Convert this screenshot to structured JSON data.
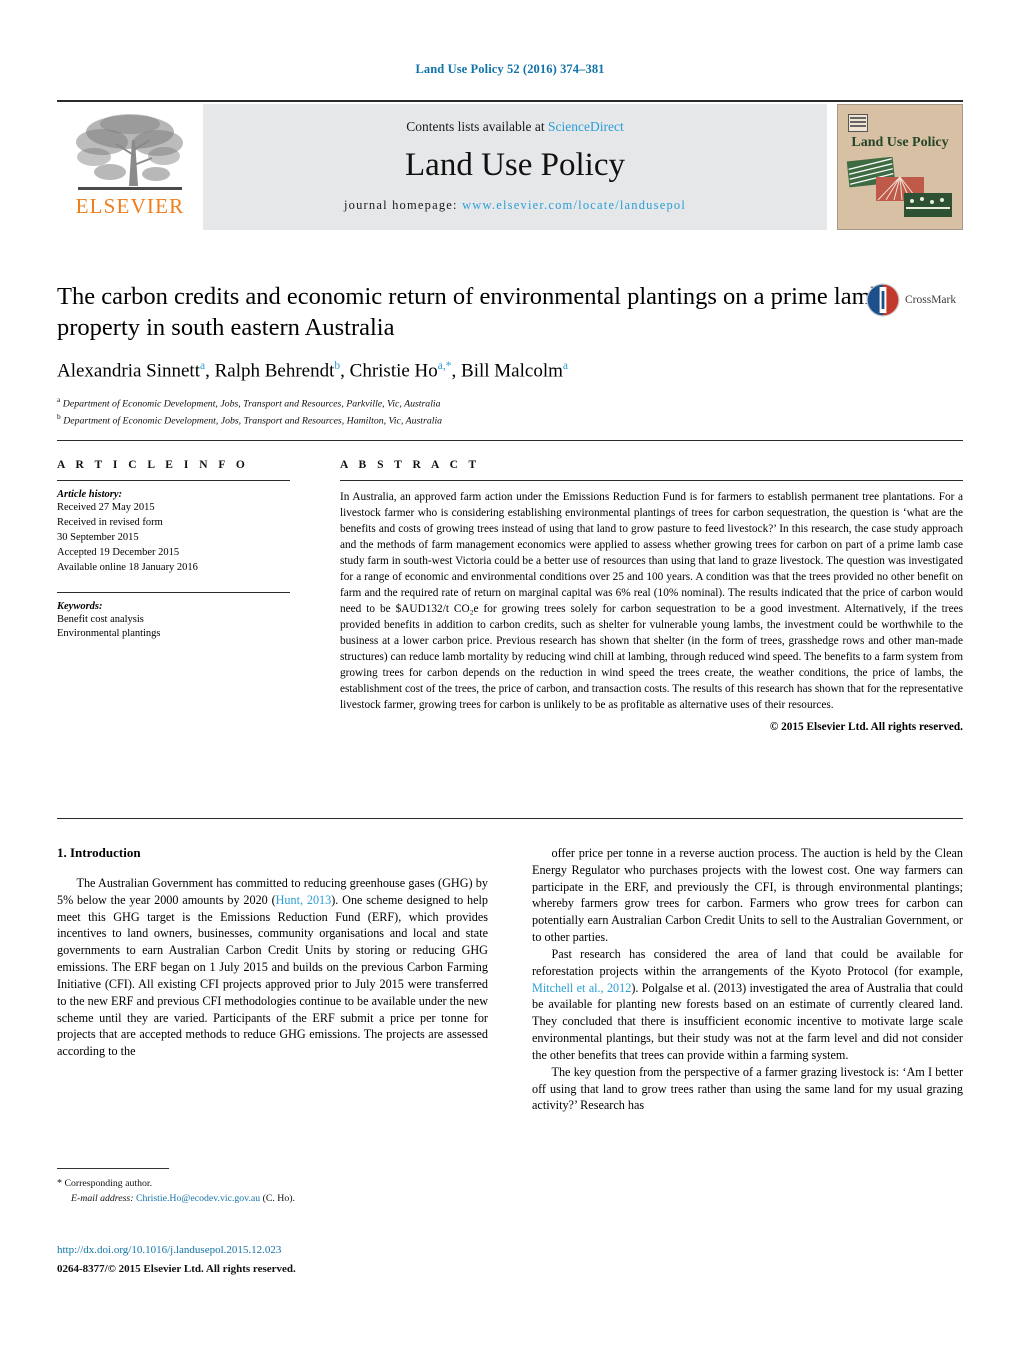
{
  "running_head": "Land Use Policy 52 (2016) 374–381",
  "masthead": {
    "contents_prefix": "Contents lists available at ",
    "sciencedirect": "ScienceDirect",
    "journal_title": "Land Use Policy",
    "homepage_prefix": "journal homepage: ",
    "homepage_url": "www.elsevier.com/locate/landusepol",
    "publisher_wordmark": "ELSEVIER",
    "cover_title": "Land Use Policy",
    "colors": {
      "elsevier_orange": "#ef7d1a",
      "link_blue": "#2a9fd6",
      "band_gray": "#e6e7e9",
      "cover_tan": "#d8c0a4",
      "cover_green": "#25452a"
    }
  },
  "crossmark": {
    "label": "CrossMark"
  },
  "article": {
    "title": "The carbon credits and economic return of environmental plantings on a prime lamb property in south eastern Australia",
    "authors_html": "Alexandria Sinnett<sup>a</sup>, Ralph Behrendt<sup>b</sup>, Christie Ho<sup>a,</sup><sup>*</sup>, Bill Malcolm<sup>a</sup>",
    "affiliations": [
      {
        "marker": "a",
        "text": "Department of Economic Development, Jobs, Transport and Resources, Parkville, Vic, Australia"
      },
      {
        "marker": "b",
        "text": "Department of Economic Development, Jobs, Transport and Resources, Hamilton, Vic, Australia"
      }
    ]
  },
  "article_info": {
    "heading": "A R T I C L E   I N F O",
    "history_label": "Article history:",
    "history_lines": [
      "Received 27 May 2015",
      "Received in revised form",
      "30 September 2015",
      "Accepted 19 December 2015",
      "Available online 18 January 2016"
    ],
    "keywords_label": "Keywords:",
    "keywords": [
      "Benefit cost analysis",
      "Environmental plantings"
    ]
  },
  "abstract": {
    "heading": "A B S T R A C T",
    "body": "In Australia, an approved farm action under the Emissions Reduction Fund is for farmers to establish permanent tree plantations. For a livestock farmer who is considering establishing environmental plantings of trees for carbon sequestration, the question is ‘what are the benefits and costs of growing trees instead of using that land to grow pasture to feed livestock?’ In this research, the case study approach and the methods of farm management economics were applied to assess whether growing trees for carbon on part of a prime lamb case study farm in south-west Victoria could be a better use of resources than using that land to graze livestock. The question was investigated for a range of economic and environmental conditions over 25 and 100 years. A condition was that the trees provided no other benefit on farm and the required rate of return on marginal capital was 6% real (10% nominal). The results indicated that the price of carbon would need to be $AUD132/t CO₂e for growing trees solely for carbon sequestration to be a good investment. Alternatively, if the trees provided benefits in addition to carbon credits, such as shelter for vulnerable young lambs, the investment could be worthwhile to the business at a lower carbon price. Previous research has shown that shelter (in the form of trees, grasshedge rows and other man-made structures) can reduce lamb mortality by reducing wind chill at lambing, through reduced wind speed. The benefits to a farm system from growing trees for carbon depends on the reduction in wind speed the trees create, the weather conditions, the price of lambs, the establishment cost of the trees, the price of carbon, and transaction costs. The results of this research has shown that for the representative livestock farmer, growing trees for carbon is unlikely to be as profitable as alternative uses of their resources.",
    "copyright": "© 2015 Elsevier Ltd. All rights reserved."
  },
  "introduction": {
    "section_title": "1. Introduction",
    "left_paragraphs": [
      "The Australian Government has committed to reducing greenhouse gases (GHG) by 5% below the year 2000 amounts by 2020 (Hunt, 2013). One scheme designed to help meet this GHG target is the Emissions Reduction Fund (ERF), which provides incentives to land owners, businesses, community organisations and local and state governments to earn Australian Carbon Credit Units by storing or reducing GHG emissions. The ERF began on 1 July 2015 and builds on the previous Carbon Farming Initiative (CFI). All existing CFI projects approved prior to July 2015 were transferred to the new ERF and previous CFI methodologies continue to be available under the new scheme until they are varied. Participants of the ERF submit a price per tonne for projects that are accepted methods to reduce GHG emissions. The projects are assessed according to the"
    ],
    "right_paragraphs": [
      "offer price per tonne in a reverse auction process. The auction is held by the Clean Energy Regulator who purchases projects with the lowest cost. One way farmers can participate in the ERF, and previously the CFI, is through environmental plantings; whereby farmers grow trees for carbon. Farmers who grow trees for carbon can potentially earn Australian Carbon Credit Units to sell to the Australian Government, or to other parties.",
      "Past research has considered the area of land that could be available for reforestation projects within the arrangements of the Kyoto Protocol (for example, Mitchell et al., 2012). Polgalse et al. (2013) investigated the area of Australia that could be available for planting new forests based on an estimate of currently cleared land. They concluded that there is insufficient economic incentive to motivate large scale environmental plantings, but their study was not at the farm level and did not consider the other benefits that trees can provide within a farming system.",
      "The key question from the perspective of a farmer grazing livestock is: ‘Am I better off using that land to grow trees rather than using the same land for my usual grazing activity?’ Research has"
    ],
    "citations": [
      "Hunt, 2013",
      "Mitchell et al., 2012"
    ]
  },
  "footnote": {
    "star": "*",
    "corresponding": "Corresponding author.",
    "email_label": "E-mail address:",
    "email": "Christie.Ho@ecodev.vic.gov.au",
    "email_suffix": "(C. Ho)."
  },
  "doi_block": {
    "doi_url": "http://dx.doi.org/10.1016/j.landusepol.2015.12.023",
    "issn_line": "0264-8377/© 2015 Elsevier Ltd. All rights reserved."
  }
}
